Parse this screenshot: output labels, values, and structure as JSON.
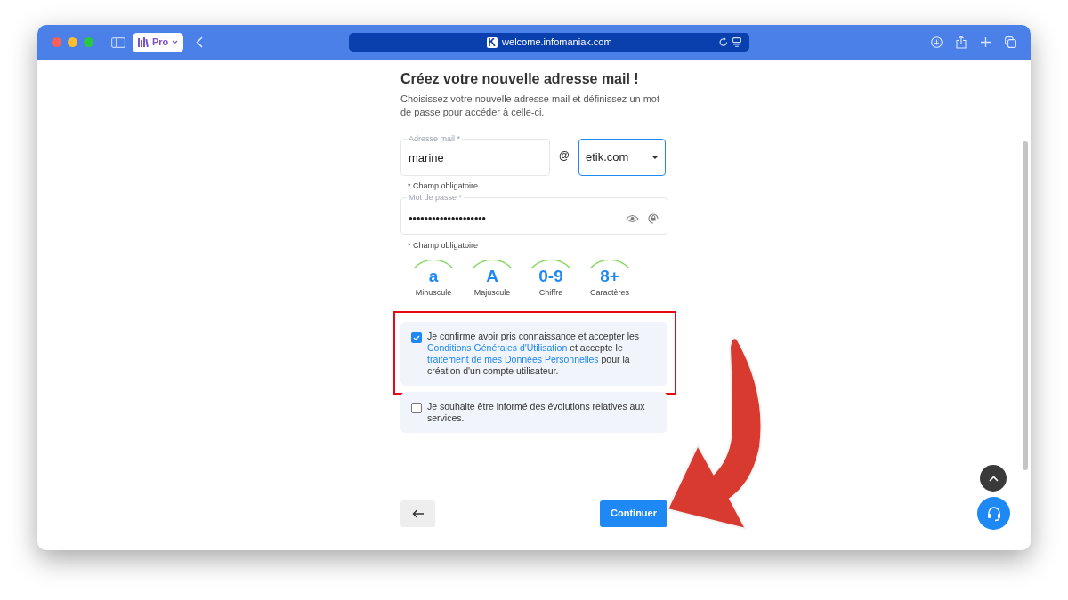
{
  "browser": {
    "profile": "Pro",
    "address": "welcome.infomaniak.com"
  },
  "form": {
    "title": "Créez votre nouvelle adresse mail !",
    "subtitle": "Choisissez votre nouvelle adresse mail et définissez un mot de passe pour accéder à celle-ci.",
    "email": {
      "label": "Adresse mail *",
      "value": "marine",
      "at": "@",
      "domain": "etik.com",
      "note": "* Champ obligatoire"
    },
    "password": {
      "label": "Mot de passe *",
      "value": "●●●●●●●●●●●●●●●●●●●●",
      "note": "* Champ obligatoire"
    },
    "strength": [
      {
        "symbol": "a",
        "caption": "Minuscule",
        "met": true
      },
      {
        "symbol": "A",
        "caption": "Majuscule",
        "met": true
      },
      {
        "symbol": "0-9",
        "caption": "Chiffre",
        "met": true
      },
      {
        "symbol": "8+",
        "caption": "Caractères",
        "met": true
      }
    ],
    "consents": [
      {
        "checked": true,
        "highlighted": true,
        "segments": [
          {
            "kind": "text",
            "text": "Je confirme avoir pris connaissance et accepter les "
          },
          {
            "kind": "link",
            "text": "Conditions Générales d'Utilisation"
          },
          {
            "kind": "text",
            "text": " et accepte le "
          },
          {
            "kind": "link",
            "text": "traitement de mes Données Personnelles"
          },
          {
            "kind": "text",
            "text": " pour la création d'un compte utilisateur."
          }
        ]
      },
      {
        "checked": false,
        "highlighted": false,
        "segments": [
          {
            "kind": "text",
            "text": "Je souhaite être informé des évolutions relatives aux services."
          }
        ]
      }
    ],
    "continue": "Continuer"
  }
}
